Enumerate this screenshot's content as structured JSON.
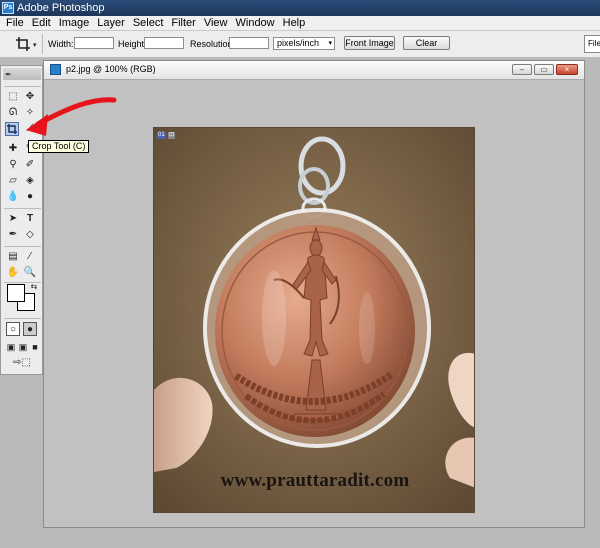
{
  "app": {
    "title": "Adobe Photoshop",
    "logo_text": "Ps"
  },
  "menu": [
    "File",
    "Edit",
    "Image",
    "Layer",
    "Select",
    "Filter",
    "View",
    "Window",
    "Help"
  ],
  "options_bar": {
    "dropdown_arrow": "▾",
    "width_label": "Width:",
    "width_value": "",
    "height_label": "Height:",
    "height_value": "",
    "resolution_label": "Resolution:",
    "resolution_value": "",
    "units_value": "pixels/inch",
    "front_image_label": "Front Image",
    "clear_label": "Clear",
    "file_browser_label": "File"
  },
  "toolbox": {
    "active_tool": "crop-tool",
    "tooltip": "Crop Tool (C)"
  },
  "document": {
    "title": "p2.jpg @ 100% (RGB)",
    "slice_number": "01",
    "slice_badge": "⊡",
    "watermark": "www.prauttaradit.com",
    "minimize_glyph": "–",
    "restore_glyph": "▭",
    "close_glyph": "×"
  },
  "colors": {
    "annotation_arrow": "#e8141c",
    "titlebar": "#1d3558",
    "workspace": "#b9b9b9"
  }
}
